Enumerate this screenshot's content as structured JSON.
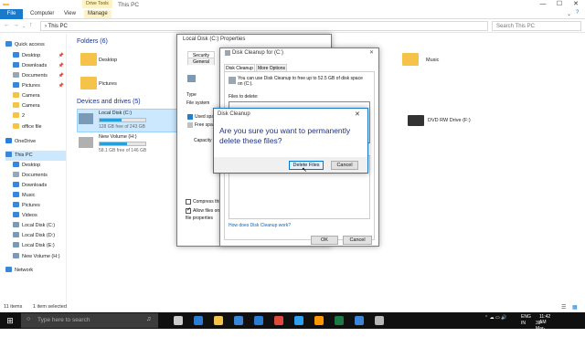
{
  "window": {
    "title": "This PC",
    "contextual_tab": "Drive Tools",
    "minimize": "—",
    "maximize": "☐",
    "close": "✕"
  },
  "ribbon": {
    "tabs": [
      "File",
      "Computer",
      "View",
      "Manage"
    ]
  },
  "address": {
    "path": "›  This PC",
    "search_placeholder": "Search This PC"
  },
  "nav": {
    "items": [
      {
        "label": "Quick access",
        "color": "#3a86d8"
      },
      {
        "label": "Desktop",
        "color": "#3a86d8",
        "pinned": "📌"
      },
      {
        "label": "Downloads",
        "color": "#3a86d8",
        "pinned": "📌"
      },
      {
        "label": "Documents",
        "color": "#9aa6b2",
        "pinned": "📌"
      },
      {
        "label": "Pictures",
        "color": "#3a86d8",
        "pinned": "📌"
      },
      {
        "label": "Camera",
        "color": "#f6c34a"
      },
      {
        "label": "Camera",
        "color": "#f6c34a"
      },
      {
        "label": "2",
        "color": "#f6c34a"
      },
      {
        "label": "office file",
        "color": "#f6c34a"
      },
      {
        "label": "OneDrive",
        "color": "#2a7de1"
      },
      {
        "label": "This PC",
        "color": "#3a86d8"
      },
      {
        "label": "Desktop",
        "color": "#3a86d8"
      },
      {
        "label": "Documents",
        "color": "#9aa6b2"
      },
      {
        "label": "Downloads",
        "color": "#3a86d8"
      },
      {
        "label": "Music",
        "color": "#3a86d8"
      },
      {
        "label": "Pictures",
        "color": "#3a86d8"
      },
      {
        "label": "Videos",
        "color": "#3a86d8"
      },
      {
        "label": "Local Disk (C:)",
        "color": "#7a9ab8"
      },
      {
        "label": "Local Disk (D:)",
        "color": "#7a9ab8"
      },
      {
        "label": "Local Disk (E:)",
        "color": "#7a9ab8"
      },
      {
        "label": "New Volume (H:)",
        "color": "#7a9ab8"
      },
      {
        "label": "Network",
        "color": "#3a86d8"
      }
    ]
  },
  "content": {
    "folders_header": "Folders (6)",
    "folders": [
      "Desktop",
      "Pictures",
      "Music"
    ],
    "devices_header": "Devices and drives (5)",
    "drives": [
      {
        "name": "Local Disk (C:)",
        "sub": "128 GB free of 243 GB",
        "used_fraction": 0.47
      },
      {
        "name": "New Volume (H:)",
        "sub": "58.1 GB free of 146 GB",
        "used_fraction": 0.6
      }
    ],
    "dvd": "DVD RW Drive (F:)"
  },
  "status": {
    "count": "11 items",
    "selected": "1 item selected"
  },
  "properties": {
    "title": "Local Disk (C:) Properties",
    "tabs": [
      "Security",
      "General"
    ],
    "type_label": "Type",
    "fs_label": "File system",
    "used_label": "Used space",
    "free_label": "Free space",
    "capacity_label": "Capacity",
    "compress_label": "Compress this",
    "allow_label": "Allow files on",
    "allow_sub": "file properties",
    "used_color": "#1f7fd6",
    "free_color": "#c0c0c0"
  },
  "cleanup": {
    "title": "Disk Cleanup for (C:)",
    "tabs": [
      "Disk Cleanup",
      "More Options"
    ],
    "desc": "You can use Disk Cleanup to free up to 52.5 GB of disk space on (C:).",
    "files_label": "Files to delete:",
    "link": "How does Disk Cleanup work?",
    "ok": "OK",
    "cancel": "Cancel"
  },
  "confirm": {
    "title": "Disk Cleanup",
    "message": "Are you sure you want to permanently delete these files?",
    "delete": "Delete Files",
    "cancel": "Cancel",
    "close": "✕"
  },
  "taskbar": {
    "search_placeholder": "Type here to search",
    "start_glyph": "⊞",
    "lang": "ENG",
    "region": "IN",
    "time": "11:42 AM",
    "date": "30-Mar-2019",
    "apps": [
      {
        "name": "task-view",
        "color": "#cccccc"
      },
      {
        "name": "edge",
        "color": "#2b7cd3"
      },
      {
        "name": "file-explorer",
        "color": "#f6c34a"
      },
      {
        "name": "store",
        "color": "#3a86d8"
      },
      {
        "name": "mail",
        "color": "#2b7cd3"
      },
      {
        "name": "chrome",
        "color": "#e04a3c"
      },
      {
        "name": "photoshop",
        "color": "#2da0f0"
      },
      {
        "name": "sublime",
        "color": "#ff9800"
      },
      {
        "name": "excel",
        "color": "#1d7a45"
      },
      {
        "name": "photos",
        "color": "#3a86d8"
      },
      {
        "name": "disk-cleanup",
        "color": "#b7b7b7"
      }
    ]
  }
}
